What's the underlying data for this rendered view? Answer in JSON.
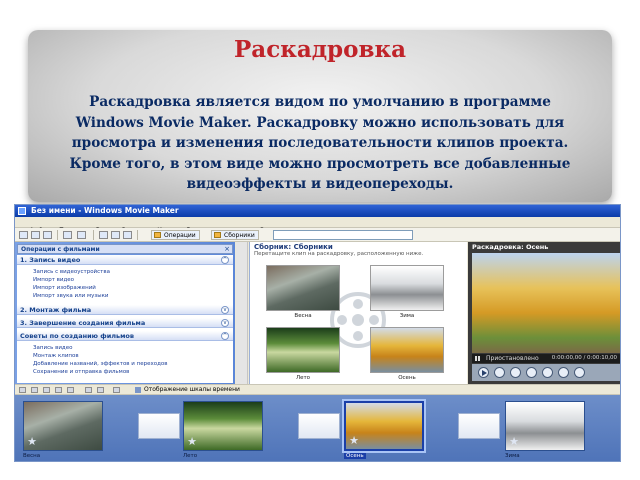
{
  "slide": {
    "title": "Раскадровка",
    "text_lines": [
      "Раскадровка является видом по умолчанию в программе",
      "Windows Movie Maker. Раскадровку можно использовать для",
      "просмотра и изменения последовательности клипов проекта.",
      "Кроме того, в этом виде можно просмотреть все добавленные",
      "видеоэффекты и видеопереходы."
    ]
  },
  "window": {
    "title": "Без имени - Windows Movie Maker",
    "menu": [
      "Файл",
      "Правка",
      "Вид",
      "Сервис",
      "Клип",
      "Воспроизведение",
      "Справка"
    ],
    "toolbar": {
      "tasks_label": "Операции",
      "collections_label": "Сборники"
    }
  },
  "tasks_pane": {
    "header": "Операции с фильмами",
    "sections": [
      {
        "title": "1. Запись видео",
        "links": [
          "Запись с видеоустройства",
          "Импорт видео",
          "Импорт изображений",
          "Импорт звука или музыки"
        ]
      },
      {
        "title": "2. Монтаж фильма",
        "links": []
      },
      {
        "title": "3. Завершение создания фильма",
        "links": []
      },
      {
        "title": "Советы по созданию фильмов",
        "links": [
          "Запись видео",
          "Монтаж клипов",
          "Добавление названий, эффектов и переходов",
          "Сохранение и отправка фильмов"
        ]
      }
    ]
  },
  "collections": {
    "title": "Сборник: Сборники",
    "subtitle": "Перетащите клип на раскадровку, расположенную ниже.",
    "clips": [
      "Весна",
      "Зима",
      "Лето",
      "Осень"
    ]
  },
  "monitor": {
    "title": "Раскадровка: Осень",
    "status": "Приостановлено",
    "time": "0:00:00,00 / 0:00:10,00"
  },
  "storyboard": {
    "toolbar_label": "Отображение шкалы времени",
    "clips": [
      "Весна",
      "Лето",
      "Осень",
      "Зима"
    ],
    "selected_index": 2
  }
}
